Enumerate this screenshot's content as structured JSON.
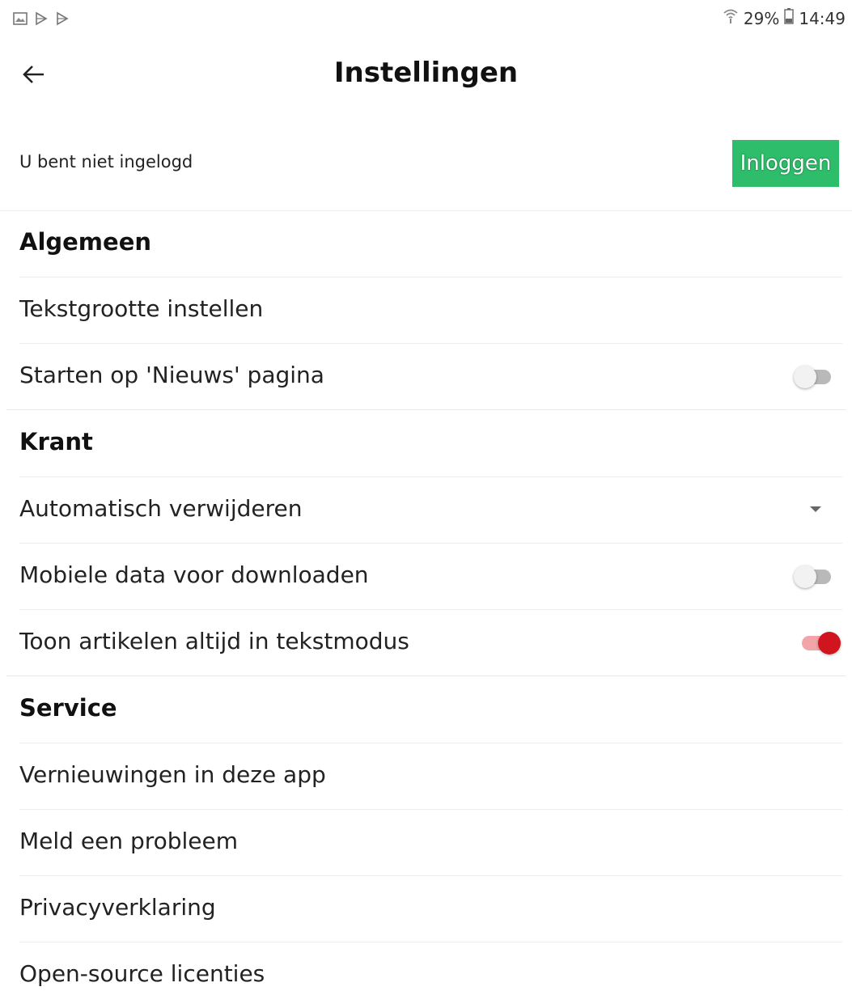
{
  "status_bar": {
    "notification_icons": [
      "image-icon",
      "play-icon",
      "play-icon"
    ],
    "battery_percent": "29%",
    "time": "14:49"
  },
  "app_bar": {
    "title": "Instellingen"
  },
  "login": {
    "status_text": "U bent niet ingelogd",
    "button_label": "Inloggen",
    "button_color": "#2ebd6b"
  },
  "sections": {
    "general": {
      "title": "Algemeen",
      "items": [
        {
          "label": "Tekstgrootte instellen"
        },
        {
          "label": "Starten op 'Nieuws' pagina",
          "toggle": false
        }
      ]
    },
    "newspaper": {
      "title": "Krant",
      "items": [
        {
          "label": "Automatisch verwijderen"
        },
        {
          "label": "Mobiele data voor downloaden",
          "toggle": false
        },
        {
          "label": "Toon artikelen altijd in tekstmodus",
          "toggle": true
        }
      ]
    },
    "service": {
      "title": "Service",
      "items": [
        {
          "label": "Vernieuwingen in deze app"
        },
        {
          "label": "Meld een probleem"
        },
        {
          "label": "Privacyverklaring"
        },
        {
          "label": "Open-source licenties"
        }
      ]
    }
  },
  "colors": {
    "toggle_on_thumb": "#d0151f",
    "toggle_on_track": "#f3a4a8",
    "toggle_off_track": "#b9b9b9"
  }
}
